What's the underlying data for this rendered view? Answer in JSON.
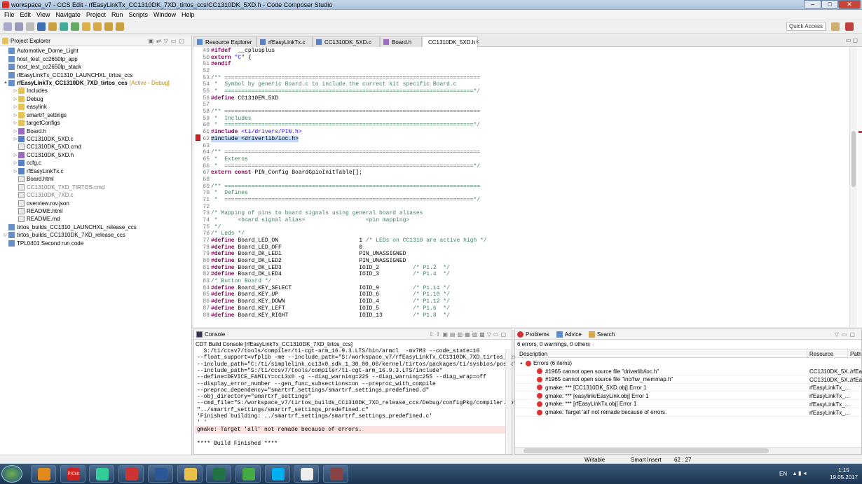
{
  "window": {
    "title": "workspace_v7 - CCS Edit - rfEasyLinkTx_CC1310DK_7XD_tirtos_ccs/CC1310DK_5XD.h - Code Composer Studio",
    "min": "–",
    "max": "□",
    "close": "✕"
  },
  "menu": [
    "File",
    "Edit",
    "View",
    "Navigate",
    "Project",
    "Run",
    "Scripts",
    "Window",
    "Help"
  ],
  "quick_access": "Quick Access",
  "project_explorer": {
    "title": "Project Explorer",
    "items": [
      {
        "label": "Automotive_Dome_Light",
        "level": 0,
        "icon": "proj",
        "tw": ""
      },
      {
        "label": "host_test_cc2650lp_app",
        "level": 0,
        "icon": "proj",
        "tw": ""
      },
      {
        "label": "host_test_cc2650lp_stack",
        "level": 0,
        "icon": "proj",
        "tw": ""
      },
      {
        "label": "rfEasyLinkTx_CC1310_LAUNCHXL_tirtos_ccs",
        "level": 0,
        "icon": "proj",
        "tw": ""
      },
      {
        "label": "rfEasyLinkTx_CC1310DK_7XD_tirtos_ccs",
        "level": 0,
        "icon": "proj",
        "tw": "▲",
        "bold": true,
        "suffix": "[Active - Debug]"
      },
      {
        "label": "Includes",
        "level": 1,
        "icon": "fold",
        "tw": "▷"
      },
      {
        "label": "Debug",
        "level": 1,
        "icon": "fold",
        "tw": "▷"
      },
      {
        "label": "easylink",
        "level": 1,
        "icon": "fold",
        "tw": "▷"
      },
      {
        "label": "smartrf_settings",
        "level": 1,
        "icon": "fold",
        "tw": "▷"
      },
      {
        "label": "targetConfigs",
        "level": 1,
        "icon": "fold",
        "tw": "▷"
      },
      {
        "label": "Board.h",
        "level": 1,
        "icon": "hfile",
        "tw": "▷"
      },
      {
        "label": "CC1310DK_5XD.c",
        "level": 1,
        "icon": "cfile",
        "tw": "▷"
      },
      {
        "label": "CC1310DK_5XD.cmd",
        "level": 1,
        "icon": "file",
        "tw": ""
      },
      {
        "label": "CC1310DK_5XD.h",
        "level": 1,
        "icon": "hfile",
        "tw": "▷"
      },
      {
        "label": "ccfg.c",
        "level": 1,
        "icon": "cfile",
        "tw": "▷"
      },
      {
        "label": "rfEasyLinkTx.c",
        "level": 1,
        "icon": "cfile",
        "tw": "▷"
      },
      {
        "label": "Board.html",
        "level": 1,
        "icon": "file",
        "tw": ""
      },
      {
        "label": "CC1310DK_7XD_TIRTOS.cmd",
        "level": 1,
        "icon": "file",
        "tw": "",
        "grey": true
      },
      {
        "label": "CC1310DK_7XD.c",
        "level": 1,
        "icon": "file",
        "tw": "",
        "grey": true
      },
      {
        "label": "overview.rov.json",
        "level": 1,
        "icon": "file",
        "tw": ""
      },
      {
        "label": "README.html",
        "level": 1,
        "icon": "file",
        "tw": ""
      },
      {
        "label": "README.md",
        "level": 1,
        "icon": "file",
        "tw": ""
      },
      {
        "label": "tirtos_builds_CC1310_LAUNCHXL_release_ccs",
        "level": 0,
        "icon": "proj",
        "tw": ""
      },
      {
        "label": "tirtos_builds_CC1310DK_7XD_release_ccs",
        "level": 0,
        "icon": "proj",
        "tw": "▷"
      },
      {
        "label": "TPL0401 Second run code",
        "level": 0,
        "icon": "proj",
        "tw": ""
      }
    ]
  },
  "editor_tabs": [
    {
      "label": "Resource Explorer",
      "selected": false
    },
    {
      "label": "rfEasyLinkTx.c",
      "selected": false
    },
    {
      "label": "CC1310DK_5XD.c",
      "selected": false
    },
    {
      "label": "Board.h",
      "selected": false
    },
    {
      "label": "CC1310DK_5XD.h",
      "selected": true,
      "close": "✕"
    }
  ],
  "code_lines": [
    {
      "n": "49",
      "t": [
        [
          "kw",
          "#ifdef"
        ],
        [
          "",
          "  __cplusplus"
        ]
      ]
    },
    {
      "n": "50",
      "t": [
        [
          "kw",
          "extern"
        ],
        [
          "st",
          " \"C\""
        ],
        [
          "",
          " {"
        ]
      ]
    },
    {
      "n": "51",
      "t": [
        [
          "kw",
          "#endif"
        ]
      ]
    },
    {
      "n": "52",
      "t": []
    },
    {
      "n": "53",
      "t": [
        [
          "cm",
          "/** ============================================================================"
        ]
      ]
    },
    {
      "n": "54",
      "t": [
        [
          "cm",
          " *  Symbol by generic Board.c to include the correct kit specific Board.c"
        ]
      ]
    },
    {
      "n": "55",
      "t": [
        [
          "cm",
          " *  ==========================================================================*/"
        ]
      ]
    },
    {
      "n": "56",
      "t": [
        [
          "kw",
          "#define"
        ],
        [
          "",
          " CC1310EM_5XD"
        ]
      ]
    },
    {
      "n": "57",
      "t": []
    },
    {
      "n": "58",
      "t": [
        [
          "cm",
          "/** ============================================================================"
        ]
      ]
    },
    {
      "n": "59",
      "t": [
        [
          "cm",
          " *  Includes"
        ]
      ]
    },
    {
      "n": "60",
      "t": [
        [
          "cm",
          " *  ==========================================================================*/"
        ]
      ]
    },
    {
      "n": "61",
      "t": [
        [
          "kw",
          "#include"
        ],
        [
          "st",
          " <ti/drivers/PIN.h>"
        ]
      ]
    },
    {
      "n": "62",
      "t": [
        [
          "hl",
          "#include <driverlib/ioc.h>"
        ]
      ]
    },
    {
      "n": "63",
      "t": []
    },
    {
      "n": "64",
      "t": [
        [
          "cm",
          "/** ============================================================================"
        ]
      ]
    },
    {
      "n": "65",
      "t": [
        [
          "cm",
          " *  Externs"
        ]
      ]
    },
    {
      "n": "66",
      "t": [
        [
          "cm",
          " *  ==========================================================================*/"
        ]
      ]
    },
    {
      "n": "67",
      "t": [
        [
          "kw",
          "extern const"
        ],
        [
          "",
          " PIN_Config BoardGpioInitTable[];"
        ]
      ]
    },
    {
      "n": "68",
      "t": []
    },
    {
      "n": "69",
      "t": [
        [
          "cm",
          "/** ============================================================================"
        ]
      ]
    },
    {
      "n": "70",
      "t": [
        [
          "cm",
          " *  Defines"
        ]
      ]
    },
    {
      "n": "71",
      "t": [
        [
          "cm",
          " *  ==========================================================================*/"
        ]
      ]
    },
    {
      "n": "72",
      "t": []
    },
    {
      "n": "73",
      "t": [
        [
          "cm",
          "/* Mapping of pins to board signals using general board aliases"
        ]
      ]
    },
    {
      "n": "74",
      "t": [
        [
          "cm",
          " *      <board signal alias>                  <pin mapping>"
        ]
      ]
    },
    {
      "n": "75",
      "t": [
        [
          "cm",
          " */"
        ]
      ]
    },
    {
      "n": "76",
      "t": [
        [
          "cm",
          "/* Leds */"
        ]
      ]
    },
    {
      "n": "77",
      "t": [
        [
          "kw",
          "#define"
        ],
        [
          "",
          " Board_LED_ON                        1 "
        ],
        [
          "cm",
          "/* LEDs on CC1310 are active high */"
        ]
      ]
    },
    {
      "n": "78",
      "t": [
        [
          "kw",
          "#define"
        ],
        [
          "",
          " Board_LED_OFF                       0"
        ]
      ]
    },
    {
      "n": "79",
      "t": [
        [
          "kw",
          "#define"
        ],
        [
          "",
          " Board_DK_LED1                       PIN_UNASSIGNED"
        ]
      ]
    },
    {
      "n": "80",
      "t": [
        [
          "kw",
          "#define"
        ],
        [
          "",
          " Board_DK_LED2                       PIN_UNASSIGNED"
        ]
      ]
    },
    {
      "n": "81",
      "t": [
        [
          "kw",
          "#define"
        ],
        [
          "",
          " Board_DK_LED3                       IOID_2          "
        ],
        [
          "cm",
          "/* P1.2  */"
        ]
      ]
    },
    {
      "n": "82",
      "t": [
        [
          "kw",
          "#define"
        ],
        [
          "",
          " Board_DK_LED4                       IOID_3          "
        ],
        [
          "cm",
          "/* P1.4  */"
        ]
      ]
    },
    {
      "n": "83",
      "t": [
        [
          "cm",
          "/* Button Board */"
        ]
      ]
    },
    {
      "n": "84",
      "t": [
        [
          "kw",
          "#define"
        ],
        [
          "",
          " Board_KEY_SELECT                    IOID_9          "
        ],
        [
          "cm",
          "/* P1.14 */"
        ]
      ]
    },
    {
      "n": "85",
      "t": [
        [
          "kw",
          "#define"
        ],
        [
          "",
          " Board_KEY_UP                        IOID_6          "
        ],
        [
          "cm",
          "/* P1.10 */"
        ]
      ]
    },
    {
      "n": "86",
      "t": [
        [
          "kw",
          "#define"
        ],
        [
          "",
          " Board_KEY_DOWN                      IOID_4          "
        ],
        [
          "cm",
          "/* P1.12 */"
        ]
      ]
    },
    {
      "n": "87",
      "t": [
        [
          "kw",
          "#define"
        ],
        [
          "",
          " Board_KEY_LEFT                      IOID_5          "
        ],
        [
          "cm",
          "/* P1.6  */"
        ]
      ]
    },
    {
      "n": "88",
      "t": [
        [
          "kw",
          "#define"
        ],
        [
          "",
          " Board_KEY_RIGHT                     IOID_13         "
        ],
        [
          "cm",
          "/* P1.8  */"
        ]
      ]
    }
  ],
  "console": {
    "title": "Console",
    "subtitle": "CDT Build Console [rfEasyLinkTx_CC1310DK_7XD_tirtos_ccs]",
    "lines": [
      "  S:/ti/ccsv7/tools/compiler/ti-cgt-arm_16.9.3.LTS/bin/armcl  -mv7M3 --code_state=16",
      "--float_support=vfplib -me --include_path=\"S:/workspace_v7/rfEasyLinkTx_CC1310DK_7XD_tirtos_ccs\"",
      "--include_path=\"C:/ti/simplelink_cc13x0_sdk_1_30_00_06/kernel/tirtos/packages/ti/sysbios/posix\"",
      "--include_path=\"S:/ti/ccsv7/tools/compiler/ti-cgt-arm_16.9.3.LTS/include\"",
      "--define=DEVICE_FAMILY=cc13x0 -g --diag_warning=225 --diag_warning=255 --diag_wrap=off",
      "--display_error_number --gen_func_subsections=on --preproc_with_compile",
      "--preproc_dependency=\"smartrf_settings/smartrf_settings_predefined.d\"",
      "--obj_directory=\"smartrf_settings\"",
      "--cmd_file=\"S:/workspace_v7/tirtos_builds_CC1310DK_7XD_release_ccs/Debug/configPkg/compiler.opt\"",
      "\"../smartrf_settings/smartrf_settings_predefined.c\"",
      "'Finished building: ../smartrf_settings/smartrf_settings_predefined.c'",
      "' '"
    ],
    "error_line": "gmake: Target 'all' not remade because of errors.",
    "finish": "**** Build Finished ****"
  },
  "problems": {
    "tabs": [
      "Problems",
      "Advice",
      "Search"
    ],
    "summary": "6 errors, 0 warnings, 0 others",
    "col_description": "Description",
    "col_resource": "Resource",
    "col_path": "Path",
    "group": "Errors (6 items)",
    "rows": [
      {
        "d": "#1965 cannot open source file \"driverlib/ioc.h\"",
        "r": "CC1310DK_5X...",
        "p": "/rfEa"
      },
      {
        "d": "#1965 cannot open source file \"inc/hw_memmap.h\"",
        "r": "CC1310DK_5X...",
        "p": "/rfEa"
      },
      {
        "d": "gmake: *** [CC1310DK_5XD.obj] Error 1",
        "r": "rfEasyLinkTx_...",
        "p": ""
      },
      {
        "d": "gmake: *** [easylink/EasyLink.obj] Error 1",
        "r": "rfEasyLinkTx_...",
        "p": ""
      },
      {
        "d": "gmake: *** [rfEasyLinkTx.obj] Error 1",
        "r": "rfEasyLinkTx_...",
        "p": ""
      },
      {
        "d": "gmake: Target 'all' not remade because of errors.",
        "r": "rfEasyLinkTx_...",
        "p": ""
      }
    ]
  },
  "status": {
    "writable": "Writable",
    "insert": "Smart Insert",
    "pos": "62 : 27"
  },
  "taskbar": {
    "lang": "EN",
    "time": "1:15",
    "date": "19.05.2017",
    "pickit_label": "PICkit",
    "apps": [
      "outlook",
      "pickit",
      "chrome",
      "mplab",
      "word",
      "explorer",
      "excel",
      "utorrent",
      "skype",
      "paint",
      "winrar"
    ]
  }
}
